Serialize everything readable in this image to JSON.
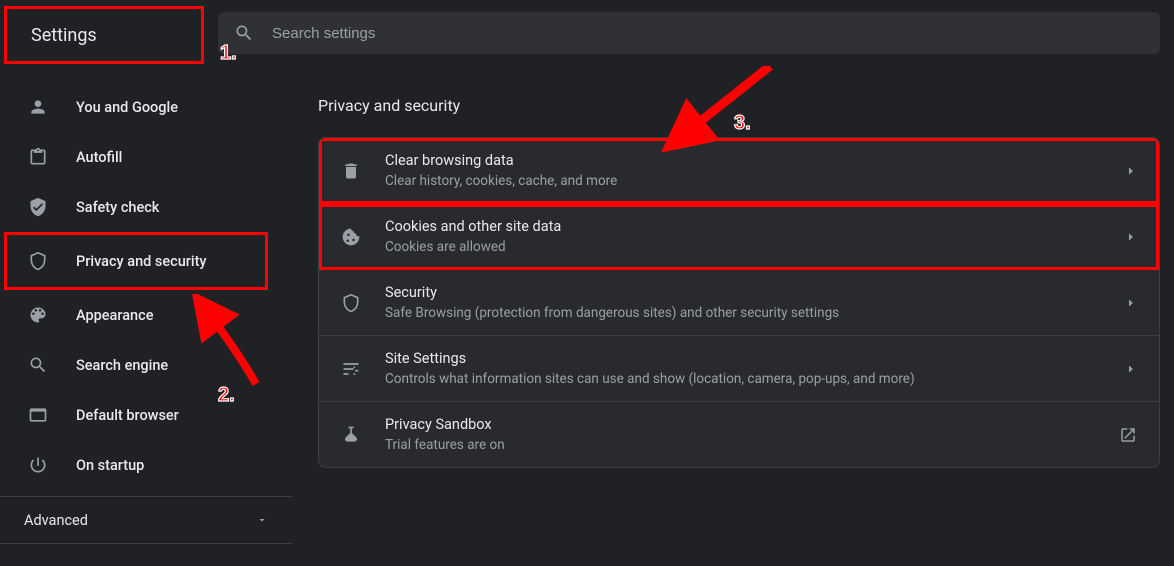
{
  "title": "Settings",
  "search": {
    "placeholder": "Search settings"
  },
  "sidebar": {
    "items": [
      {
        "label": "You and Google"
      },
      {
        "label": "Autofill"
      },
      {
        "label": "Safety check"
      },
      {
        "label": "Privacy and security"
      },
      {
        "label": "Appearance"
      },
      {
        "label": "Search engine"
      },
      {
        "label": "Default browser"
      },
      {
        "label": "On startup"
      }
    ],
    "advanced": "Advanced"
  },
  "content": {
    "section_title": "Privacy and security",
    "rows": [
      {
        "title": "Clear browsing data",
        "sub": "Clear history, cookies, cache, and more"
      },
      {
        "title": "Cookies and other site data",
        "sub": "Cookies are allowed"
      },
      {
        "title": "Security",
        "sub": "Safe Browsing (protection from dangerous sites) and other security settings"
      },
      {
        "title": "Site Settings",
        "sub": "Controls what information sites can use and show (location, camera, pop-ups, and more)"
      },
      {
        "title": "Privacy Sandbox",
        "sub": "Trial features are on"
      }
    ]
  },
  "annotations": {
    "a1": "1.",
    "a2": "2.",
    "a3": "3."
  }
}
